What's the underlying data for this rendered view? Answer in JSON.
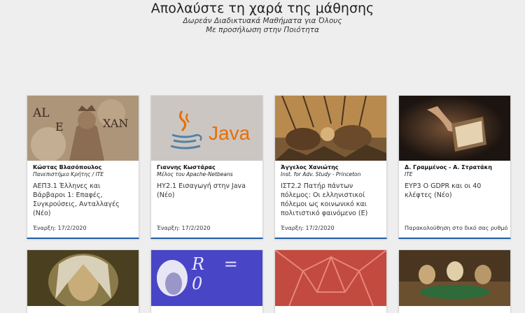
{
  "hero": {
    "title": "Απολαύστε τη χαρά της μάθησης",
    "subtitle1": "Δωρεάν Διαδικτυακά Μαθήματα για Όλους",
    "subtitle2": "Με προσήλωση στην Ποιότητα"
  },
  "courses": [
    {
      "author": "Κώστας Βλασόπουλος",
      "institution": "Πανεπιστήμιο Κρήτης / ITE",
      "title": "ΑΕΠ3.1 Έλληνες και Βάρβαροι 1: Επαφές, Συγκρούσεις, Ανταλλαγές (Νέο)",
      "footer": "Έναρξη: 17/2/2020",
      "image": "mosaic-alexander"
    },
    {
      "author": "Γιαννης Κωστάρας",
      "institution": "Μέλος του Apache-Netbeans",
      "title": "ΗΥ2.1 Εισαγωγή στην Java (Νέο)",
      "footer": "Έναρξη: 17/2/2020",
      "image": "java-logo",
      "logo_text": "Java"
    },
    {
      "author": "Άγγελος Χανιώτης",
      "institution": "Inst. for Adv. Study - Princeton",
      "title": "ΙΣΤ2.2 Πατήρ πάντων πόλεμος: Οι ελληνιστικοί πόλεμοι ως κοινωνικό και πολιτιστικό φαινόμενο (Ε)",
      "footer": "Έναρξη: 17/2/2020",
      "image": "battle-mosaic"
    },
    {
      "author": "Δ. Γραμμένος - Α. Στρατάκη",
      "institution": "ITE",
      "title": "ΕΥΡ3 Ο GDPR και οι 40 κλέφτες (Νέο)",
      "footer": "Παρακολούθηση στο δικό σας ρυθμό",
      "image": "book-hand"
    }
  ],
  "courses_row2": [
    {
      "image": "newton-portrait"
    },
    {
      "image": "einstein-blackboard",
      "board_text": "R = 0"
    },
    {
      "image": "red-geometry"
    },
    {
      "image": "dogs-poker"
    }
  ],
  "colors": {
    "background": "#eeeeee",
    "card_accent": "#1f5ea8",
    "java_orange": "#e76f00",
    "java_blue": "#5382a1"
  }
}
